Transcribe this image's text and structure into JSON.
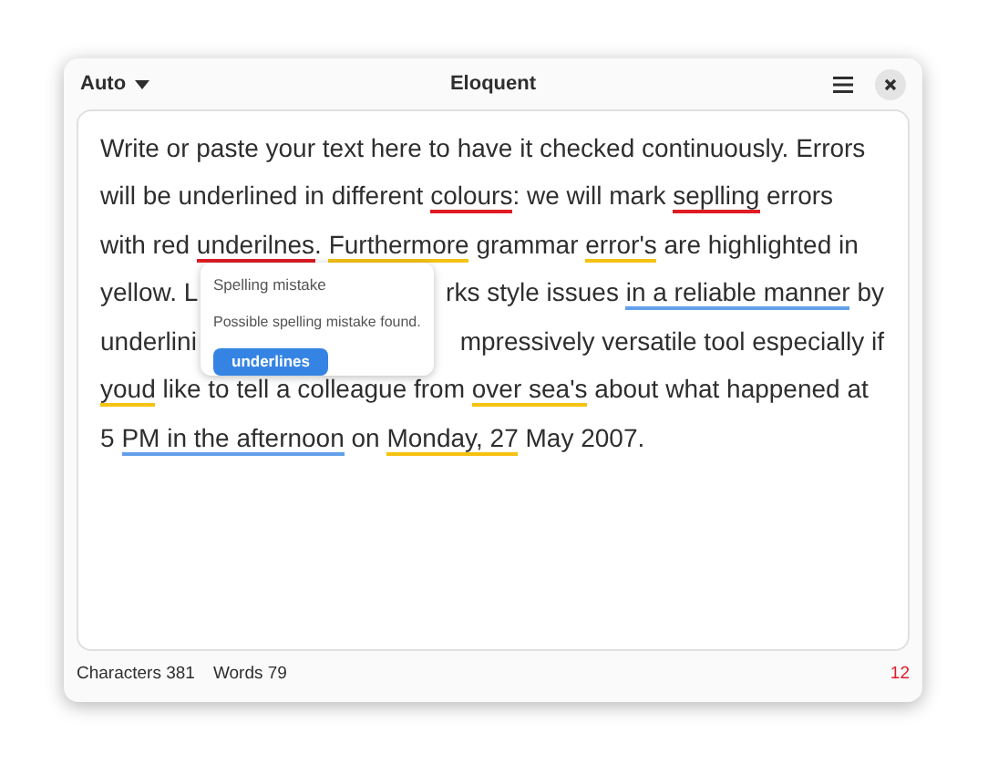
{
  "header": {
    "language": "Auto",
    "title": "Eloquent"
  },
  "lines": [
    {
      "parts": [
        [
          {
            "text": "Write or paste your text here to have it checked continuously. Errors",
            "kind": "plain"
          }
        ]
      ]
    },
    {
      "parts": [
        [
          {
            "text": "will be underlined in different ",
            "kind": "plain"
          },
          {
            "text": "colours",
            "kind": "spelling"
          },
          {
            "text": ": we will mark ",
            "kind": "plain"
          },
          {
            "text": "seplling",
            "kind": "spelling"
          },
          {
            "text": " errors",
            "kind": "plain"
          }
        ]
      ]
    },
    {
      "parts": [
        [
          {
            "text": "with red ",
            "kind": "plain"
          },
          {
            "text": "underilnes",
            "kind": "spelling"
          },
          {
            "text": ". ",
            "kind": "plain"
          },
          {
            "text": "Furthermore",
            "kind": "grammar"
          },
          {
            "text": " grammar ",
            "kind": "plain"
          },
          {
            "text": "error's",
            "kind": "grammar"
          },
          {
            "text": " are highlighted in",
            "kind": "plain"
          }
        ]
      ]
    },
    {
      "parts": [
        [
          {
            "text": "yellow. L",
            "kind": "plain"
          }
        ],
        [
          {
            "text": "rks style issues ",
            "kind": "plain"
          },
          {
            "text": "in a reliable manner",
            "kind": "style"
          },
          {
            "text": " by",
            "kind": "plain"
          }
        ]
      ]
    },
    {
      "parts": [
        [
          {
            "text": "underlini",
            "kind": "plain"
          }
        ],
        [
          {
            "text": "mpressively versatile tool especially if",
            "kind": "plain"
          }
        ]
      ]
    },
    {
      "parts": [
        [
          {
            "text": "youd",
            "kind": "grammar"
          },
          {
            "text": " like to tell a colleague from ",
            "kind": "plain"
          },
          {
            "text": "over sea's",
            "kind": "grammar"
          },
          {
            "text": " about what happened at",
            "kind": "plain"
          }
        ]
      ]
    },
    {
      "parts": [
        [
          {
            "text": "5 ",
            "kind": "plain"
          },
          {
            "text": "PM in the afternoon",
            "kind": "style"
          },
          {
            "text": " on ",
            "kind": "plain"
          },
          {
            "text": "Monday, 27",
            "kind": "grammar"
          },
          {
            "text": " May 2007.",
            "kind": "plain"
          }
        ]
      ]
    }
  ],
  "popover": {
    "title": "Spelling mistake",
    "message": "Possible spelling mistake found.",
    "suggestion": "underlines"
  },
  "status_bar": {
    "characters": "Characters 381",
    "words": "Words 79",
    "issues": "12"
  }
}
